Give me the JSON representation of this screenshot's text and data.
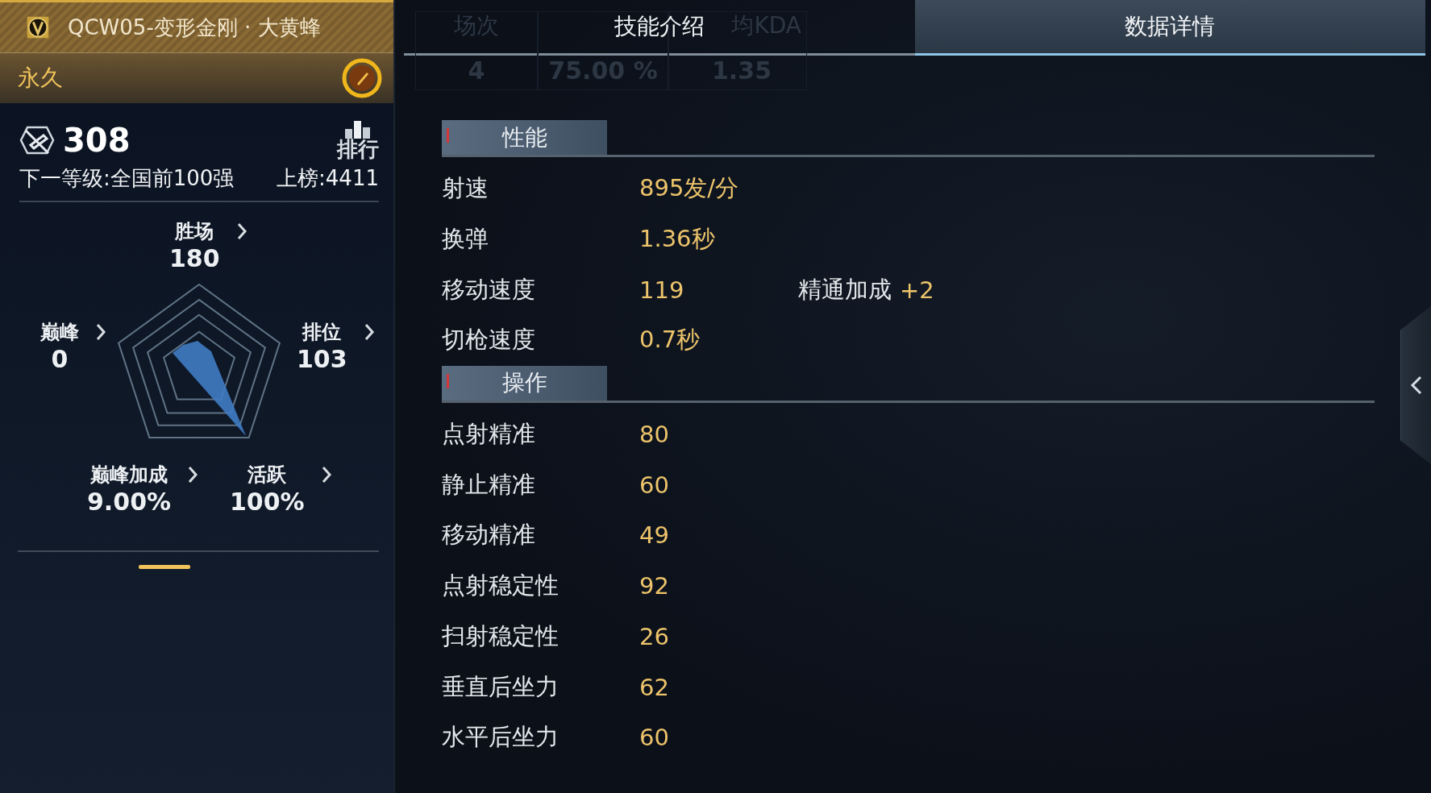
{
  "header": {
    "title": "QCW05-变形金刚 · 大黄蜂",
    "duration": "永久"
  },
  "score": {
    "value": "308",
    "rank_button": "排行",
    "next_level": "下一等级:全国前100强",
    "on_list": "上榜:4411"
  },
  "radar_stats": [
    {
      "label": "胜场",
      "value": "180"
    },
    {
      "label": "巅峰",
      "value": "0"
    },
    {
      "label": "排位",
      "value": "103"
    },
    {
      "label": "巅峰加成",
      "value": "9.00%"
    },
    {
      "label": "活跃",
      "value": "100%"
    }
  ],
  "faded_stats": [
    {
      "label": "场次",
      "value": "4"
    },
    {
      "value": "75.00 %"
    },
    {
      "label": "均KDA",
      "value": "1.35"
    }
  ],
  "tabs": [
    {
      "label": "技能介绍",
      "selected": false
    },
    {
      "label": "数据详情",
      "selected": true
    }
  ],
  "sections": [
    {
      "title": "性能",
      "rows": [
        {
          "label": "射速",
          "value": "895发/分"
        },
        {
          "label": "换弹",
          "value": "1.36秒"
        },
        {
          "label": "移动速度",
          "value": "119",
          "bonus_label": "精通加成",
          "bonus_value": "+2"
        },
        {
          "label": "切枪速度",
          "value": "0.7秒"
        }
      ]
    },
    {
      "title": "操作",
      "rows": [
        {
          "label": "点射精准",
          "value": "80"
        },
        {
          "label": "静止精准",
          "value": "60"
        },
        {
          "label": "移动精准",
          "value": "49"
        },
        {
          "label": "点射稳定性",
          "value": "92"
        },
        {
          "label": "扫射稳定性",
          "value": "26"
        },
        {
          "label": "垂直后坐力",
          "value": "62"
        },
        {
          "label": "水平后坐力",
          "value": "60"
        }
      ]
    }
  ]
}
